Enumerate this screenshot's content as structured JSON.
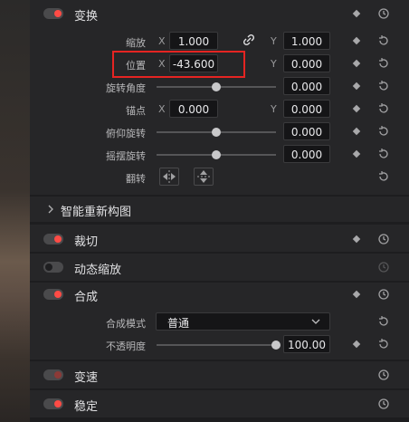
{
  "transform": {
    "title": "变换",
    "zoom": {
      "label": "缩放",
      "x_axis": "X",
      "x": "1.000",
      "y_axis": "Y",
      "y": "1.000"
    },
    "position": {
      "label": "位置",
      "x_axis": "X",
      "x": "-43.600",
      "y_axis": "Y",
      "y": "0.000"
    },
    "rotation": {
      "label": "旋转角度",
      "value": "0.000",
      "level": 0.5
    },
    "anchor": {
      "label": "锚点",
      "x_axis": "X",
      "x": "0.000",
      "y_axis": "Y",
      "y": "0.000"
    },
    "pitch": {
      "label": "俯仰旋转",
      "value": "0.000",
      "level": 0.5
    },
    "yaw": {
      "label": "摇摆旋转",
      "value": "0.000",
      "level": 0.5
    },
    "flip": {
      "label": "翻转"
    }
  },
  "smart_reframe": {
    "title": "智能重新构图"
  },
  "crop": {
    "title": "裁切"
  },
  "dynamic_zoom": {
    "title": "动态缩放"
  },
  "composite": {
    "title": "合成",
    "mode": {
      "label": "合成模式",
      "value": "普通"
    },
    "opacity": {
      "label": "不透明度",
      "value": "100.00",
      "level": 1.0
    }
  },
  "speed_change": {
    "title": "变速"
  },
  "stabilize": {
    "title": "稳定"
  },
  "colors": {
    "accent": "#ff4b45",
    "highlight": "#e52422"
  }
}
